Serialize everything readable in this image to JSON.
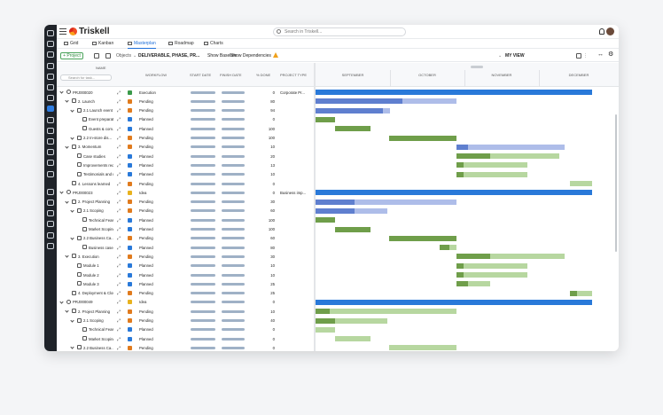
{
  "app": {
    "title": "Triskell"
  },
  "search": {
    "placeholder": "Search in Triskell..."
  },
  "tabs": [
    {
      "label": "Grid",
      "icon": "grid-icon",
      "active": false
    },
    {
      "label": "Kanban",
      "icon": "kanban-icon",
      "active": false
    },
    {
      "label": "Masterplan",
      "icon": "masterplan-icon",
      "active": true
    },
    {
      "label": "Roadmap",
      "icon": "roadmap-icon",
      "active": false
    },
    {
      "label": "Charts",
      "icon": "charts-icon",
      "active": false
    }
  ],
  "toolbar": {
    "project_btn": "+ Project",
    "objects_label": "Objects",
    "objects_value": "DELIVERABLE, PHASE, PR...",
    "show_baseline": "Show Baseline",
    "show_dependencies": "Show Dependencies",
    "view_label": "MY VIEW"
  },
  "columns": {
    "name": "NAME",
    "filter_placeholder": "Search for task...",
    "workflow": "WORKFLOW",
    "start_date": "START DATE",
    "finish_date": "FINISH DATE",
    "pct_done": "% DONE",
    "project_type": "PROJECT TYPE"
  },
  "months": [
    "SEPTEMBER",
    "OCTOBER",
    "NOVEMBER",
    "DECEMBER"
  ],
  "colors": {
    "project_bar": "#2979d9",
    "phase_dark": "#5f7fcf",
    "phase_light": "#aebde9",
    "task_dark": "#6f9e4a",
    "task_light": "#b7d7a0",
    "pending_icon": "#e07b1e",
    "planned_icon": "#2979d9",
    "execution_icon": "#3a9a4a",
    "idea_icon": "#e8b21e"
  },
  "rows": [
    {
      "level": 0,
      "chev": true,
      "icon": "project-icon",
      "name": "PRJ000020",
      "workflow": "Execution",
      "wf_icon": "arrow-right-icon",
      "pct": "0",
      "ptype": "Corporate Pr...",
      "dark": [
        0,
        100
      ],
      "light": null,
      "bar": "project"
    },
    {
      "level": 1,
      "chev": true,
      "icon": "phase-icon",
      "name": "2. Launch",
      "workflow": "Pending",
      "wf_icon": "hourglass-icon",
      "pct": "80",
      "ptype": "",
      "dark": [
        0,
        31.5
      ],
      "light": [
        31.5,
        51
      ],
      "bar": "phase"
    },
    {
      "level": 2,
      "chev": true,
      "icon": "phase-icon",
      "name": "2.1 Launch event",
      "workflow": "Pending",
      "wf_icon": "hourglass-icon",
      "pct": "94",
      "ptype": "",
      "dark": [
        0,
        24.5
      ],
      "light": [
        24.5,
        27
      ],
      "bar": "phase"
    },
    {
      "level": 3,
      "chev": false,
      "icon": "deliverable-icon",
      "name": "Event preparati...",
      "workflow": "Planned",
      "wf_icon": "calendar-icon",
      "pct": "0",
      "ptype": "",
      "dark": [
        0,
        7
      ],
      "light": null,
      "bar": "task"
    },
    {
      "level": 3,
      "chev": false,
      "icon": "deliverable-icon",
      "name": "Guests & com...",
      "workflow": "Planned",
      "wf_icon": "calendar-icon",
      "pct": "100",
      "ptype": "",
      "dark": [
        7,
        20
      ],
      "light": null,
      "bar": "task"
    },
    {
      "level": 2,
      "chev": true,
      "icon": "phase-icon",
      "name": "2.2 In-store dis...",
      "workflow": "Pending",
      "wf_icon": "hourglass-icon",
      "pct": "100",
      "ptype": "",
      "dark": [
        26.5,
        51
      ],
      "light": null,
      "bar": "task"
    },
    {
      "level": 1,
      "chev": true,
      "icon": "phase-icon",
      "name": "3. Momentum",
      "workflow": "Pending",
      "wf_icon": "hourglass-icon",
      "pct": "10",
      "ptype": "",
      "dark": [
        51,
        55
      ],
      "light": [
        55,
        90
      ],
      "bar": "phase"
    },
    {
      "level": 2,
      "chev": false,
      "icon": "deliverable-icon",
      "name": "Case studies",
      "workflow": "Planned",
      "wf_icon": "calendar-icon",
      "pct": "20",
      "ptype": "",
      "dark": [
        51,
        63
      ],
      "light": [
        63,
        88
      ],
      "bar": "task"
    },
    {
      "level": 2,
      "chev": false,
      "icon": "deliverable-icon",
      "name": "Improvements requ...",
      "workflow": "Planned",
      "wf_icon": "calendar-icon",
      "pct": "13",
      "ptype": "",
      "dark": [
        51,
        53.5
      ],
      "light": [
        53.5,
        76.5
      ],
      "bar": "task"
    },
    {
      "level": 2,
      "chev": false,
      "icon": "deliverable-icon",
      "name": "Testimonials and r...",
      "workflow": "Planned",
      "wf_icon": "calendar-icon",
      "pct": "10",
      "ptype": "",
      "dark": [
        51,
        53.5
      ],
      "light": [
        53.5,
        76.5
      ],
      "bar": "task"
    },
    {
      "level": 1,
      "chev": false,
      "icon": "phase-icon",
      "name": "4. Lessons learned",
      "workflow": "Pending",
      "wf_icon": "hourglass-icon",
      "pct": "0",
      "ptype": "",
      "dark": null,
      "light": [
        92,
        100
      ],
      "bar": "task"
    },
    {
      "level": 0,
      "chev": true,
      "icon": "project-icon",
      "name": "PRJ000023",
      "workflow": "Idea",
      "wf_icon": "bulb-icon",
      "pct": "0",
      "ptype": "Business imp...",
      "dark": [
        0,
        100
      ],
      "light": null,
      "bar": "project"
    },
    {
      "level": 1,
      "chev": true,
      "icon": "phase-icon",
      "name": "2. Project Planning",
      "workflow": "Pending",
      "wf_icon": "hourglass-icon",
      "pct": "30",
      "ptype": "",
      "dark": [
        0,
        14
      ],
      "light": [
        14,
        51
      ],
      "bar": "phase"
    },
    {
      "level": 2,
      "chev": true,
      "icon": "phase-icon",
      "name": "2.1 Scoping",
      "workflow": "Pending",
      "wf_icon": "hourglass-icon",
      "pct": "60",
      "ptype": "",
      "dark": [
        0,
        14
      ],
      "light": [
        14,
        26
      ],
      "bar": "phase"
    },
    {
      "level": 3,
      "chev": false,
      "icon": "deliverable-icon",
      "name": "Technical Feasi...",
      "workflow": "Planned",
      "wf_icon": "calendar-icon",
      "pct": "100",
      "ptype": "",
      "dark": [
        0,
        7
      ],
      "light": null,
      "bar": "task"
    },
    {
      "level": 3,
      "chev": false,
      "icon": "deliverable-icon",
      "name": "Market Scoping",
      "workflow": "Planned",
      "wf_icon": "calendar-icon",
      "pct": "100",
      "ptype": "",
      "dark": [
        7,
        20
      ],
      "light": null,
      "bar": "task"
    },
    {
      "level": 2,
      "chev": true,
      "icon": "phase-icon",
      "name": "2.2 Business Ca...",
      "workflow": "Pending",
      "wf_icon": "hourglass-icon",
      "pct": "60",
      "ptype": "",
      "dark": [
        26.5,
        51
      ],
      "light": null,
      "bar": "task"
    },
    {
      "level": 3,
      "chev": false,
      "icon": "deliverable-icon",
      "name": "Business case...",
      "workflow": "Planned",
      "wf_icon": "calendar-icon",
      "pct": "80",
      "ptype": "",
      "dark": [
        45,
        48.5
      ],
      "light": [
        48.5,
        51
      ],
      "bar": "task"
    },
    {
      "level": 1,
      "chev": true,
      "icon": "phase-icon",
      "name": "3. Execution",
      "workflow": "Pending",
      "wf_icon": "hourglass-icon",
      "pct": "30",
      "ptype": "",
      "dark": [
        51,
        63
      ],
      "light": [
        63,
        90
      ],
      "bar": "task"
    },
    {
      "level": 2,
      "chev": false,
      "icon": "deliverable-icon",
      "name": "Module 1",
      "workflow": "Planned",
      "wf_icon": "calendar-icon",
      "pct": "10",
      "ptype": "",
      "dark": [
        51,
        53.5
      ],
      "light": [
        53.5,
        76.5
      ],
      "bar": "task"
    },
    {
      "level": 2,
      "chev": false,
      "icon": "deliverable-icon",
      "name": "Module 2",
      "workflow": "Planned",
      "wf_icon": "calendar-icon",
      "pct": "10",
      "ptype": "",
      "dark": [
        51,
        53.5
      ],
      "light": [
        53.5,
        76.5
      ],
      "bar": "task"
    },
    {
      "level": 2,
      "chev": false,
      "icon": "deliverable-icon",
      "name": "Module 3",
      "workflow": "Planned",
      "wf_icon": "calendar-icon",
      "pct": "25",
      "ptype": "",
      "dark": [
        51,
        55
      ],
      "light": [
        55,
        63
      ],
      "bar": "task"
    },
    {
      "level": 1,
      "chev": false,
      "icon": "phase-icon",
      "name": "4. Deployment & Clos...",
      "workflow": "Pending",
      "wf_icon": "hourglass-icon",
      "pct": "25",
      "ptype": "",
      "dark": [
        92,
        94.5
      ],
      "light": [
        94.5,
        100
      ],
      "bar": "task"
    },
    {
      "level": 0,
      "chev": true,
      "icon": "project-icon",
      "name": "PRJ000049",
      "workflow": "Idea",
      "wf_icon": "bulb-icon",
      "pct": "0",
      "ptype": "",
      "dark": [
        0,
        100
      ],
      "light": null,
      "bar": "project"
    },
    {
      "level": 1,
      "chev": true,
      "icon": "phase-icon",
      "name": "2. Project Planning",
      "workflow": "Pending",
      "wf_icon": "hourglass-icon",
      "pct": "10",
      "ptype": "",
      "dark": [
        0,
        5
      ],
      "light": [
        5,
        51
      ],
      "bar": "task"
    },
    {
      "level": 2,
      "chev": true,
      "icon": "phase-icon",
      "name": "2.1 Scoping",
      "workflow": "Pending",
      "wf_icon": "hourglass-icon",
      "pct": "40",
      "ptype": "",
      "dark": [
        0,
        7
      ],
      "light": [
        7,
        26
      ],
      "bar": "task"
    },
    {
      "level": 3,
      "chev": false,
      "icon": "deliverable-icon",
      "name": "Technical Feasi...",
      "workflow": "Planned",
      "wf_icon": "calendar-icon",
      "pct": "0",
      "ptype": "",
      "dark": null,
      "light": [
        0,
        7
      ],
      "bar": "task"
    },
    {
      "level": 3,
      "chev": false,
      "icon": "deliverable-icon",
      "name": "Market Scoping",
      "workflow": "Planned",
      "wf_icon": "calendar-icon",
      "pct": "0",
      "ptype": "",
      "dark": null,
      "light": [
        7,
        20
      ],
      "bar": "task"
    },
    {
      "level": 2,
      "chev": true,
      "icon": "phase-icon",
      "name": "2.2 Business Ca...",
      "workflow": "Pending",
      "wf_icon": "hourglass-icon",
      "pct": "0",
      "ptype": "",
      "dark": null,
      "light": [
        26.5,
        51
      ],
      "bar": "task"
    }
  ]
}
